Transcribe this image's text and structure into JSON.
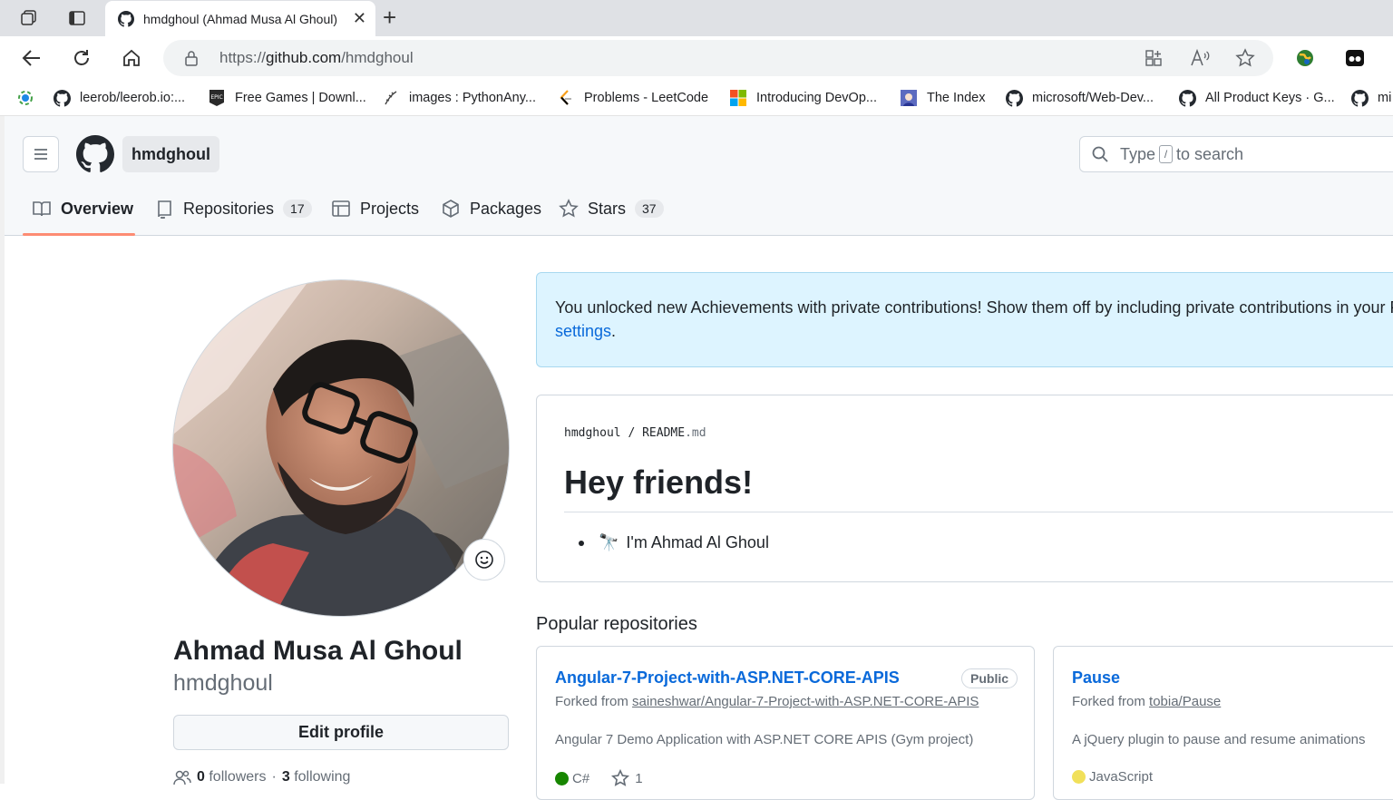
{
  "browser": {
    "tab_title": "hmdghoul (Ahmad Musa Al Ghoul)",
    "url_prefix": "https://",
    "url_host": "github.com",
    "url_path": "/hmdghoul",
    "bookmarks": [
      "leerob/leerob.io:...",
      "Free Games | Downl...",
      "images : PythonAny...",
      "Problems - LeetCode",
      "Introducing DevOp...",
      "The Index",
      "microsoft/Web-Dev...",
      "All Product Keys · G...",
      "mi"
    ]
  },
  "header": {
    "context": "hmdghoul",
    "search_prefix": "Type",
    "search_key": "/",
    "search_suffix": "to search"
  },
  "tabs": {
    "overview": "Overview",
    "repositories": "Repositories",
    "repositories_count": "17",
    "projects": "Projects",
    "packages": "Packages",
    "stars": "Stars",
    "stars_count": "37"
  },
  "profile": {
    "full_name": "Ahmad Musa Al Ghoul",
    "login": "hmdghoul",
    "edit_button": "Edit profile",
    "followers_count": "0",
    "followers_label": "followers",
    "separator": "·",
    "following_count": "3",
    "following_label": "following"
  },
  "flash": {
    "text": "You unlocked new Achievements with private contributions! Show them off by including private contributions in your Pro",
    "link": "settings",
    "end": "."
  },
  "readme": {
    "owner": "hmdghoul",
    "sep": "/",
    "file": "README",
    "ext": ".md",
    "heading": "Hey friends!",
    "bullet_emoji": "🔭",
    "bullet_text": "I'm Ahmad Al Ghoul"
  },
  "popular": {
    "title": "Popular repositories",
    "repos": [
      {
        "name": "Angular-7-Project-with-ASP.NET-CORE-APIS",
        "badge": "Public",
        "forked_prefix": "Forked from",
        "forked_from": "saineshwar/Angular-7-Project-with-ASP.NET-CORE-APIS",
        "description": "Angular 7 Demo Application with ASP.NET CORE APIS (Gym project)",
        "language": "C#",
        "language_color": "#178600",
        "stars": "1"
      },
      {
        "name": "Pause",
        "forked_prefix": "Forked from",
        "forked_from": "tobia/Pause",
        "description": "A jQuery plugin to pause and resume animations",
        "language": "JavaScript",
        "language_color": "#f1e05a"
      }
    ]
  }
}
